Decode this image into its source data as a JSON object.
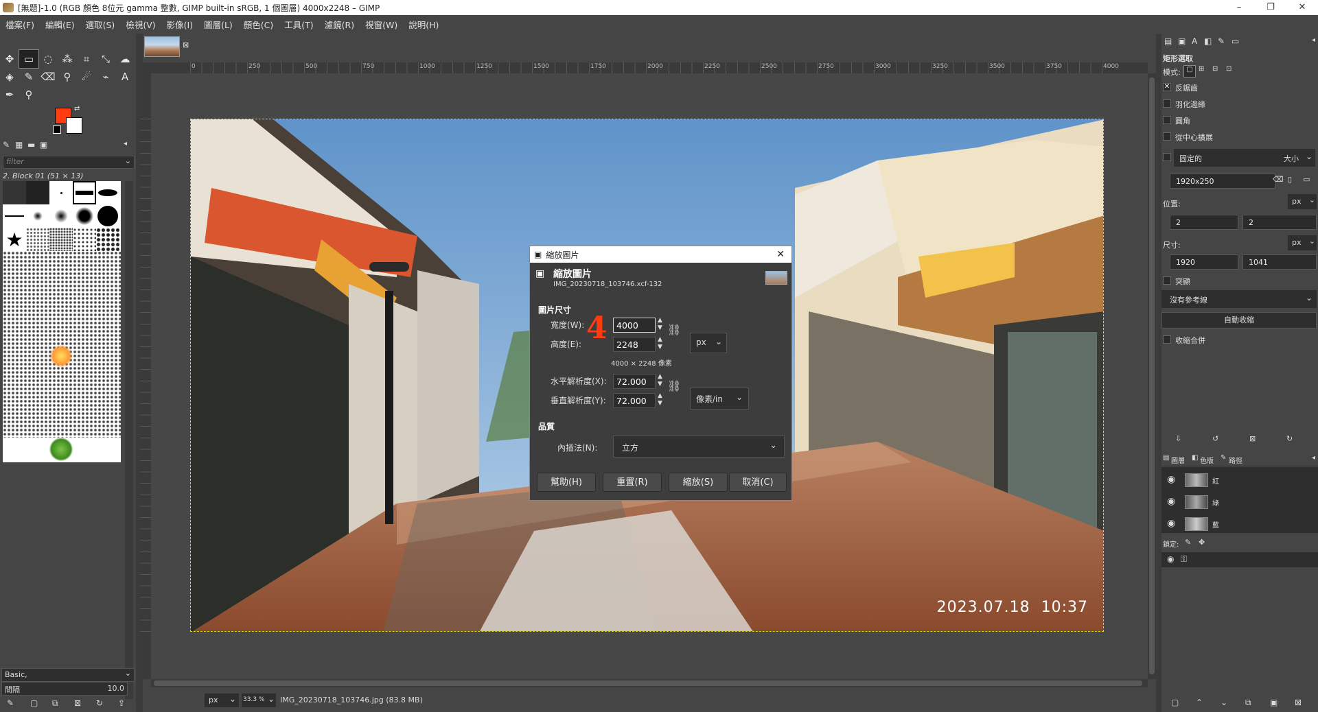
{
  "window": {
    "title": "[無題]-1.0 (RGB 顏色 8位元 gamma 整數, GIMP built-in sRGB, 1 個圖層) 4000x2248 – GIMP"
  },
  "menu": [
    "檔案(F)",
    "編輯(E)",
    "選取(S)",
    "檢視(V)",
    "影像(I)",
    "圖層(L)",
    "顏色(C)",
    "工具(T)",
    "濾鏡(R)",
    "視窗(W)",
    "說明(H)"
  ],
  "ruler_ticks": [
    "0",
    "250",
    "500",
    "750",
    "1000",
    "1250",
    "1500",
    "1750",
    "2000",
    "2250",
    "2500",
    "2750",
    "3000",
    "3250",
    "3500",
    "3750",
    "4000"
  ],
  "left_panel": {
    "filter_placeholder": "filter",
    "brush_name": "2. Block 01 (51 × 13)",
    "preset": "Basic,",
    "spacing_label": "間隔",
    "spacing_value": "10.0"
  },
  "photo": {
    "timestamp": "2023.07.18  10:37"
  },
  "dialog": {
    "title": "縮放圖片",
    "heading": "縮放圖片",
    "subtitle": "IMG_20230718_103746.xcf-132",
    "section_size": "圖片尺寸",
    "width_label": "寬度(W):",
    "width_value": "4000",
    "height_label": "高度(E):",
    "height_value": "2248",
    "size_info": "4000 × 2248 像素",
    "unit": "px",
    "xres_label": "水平解析度(X):",
    "xres_value": "72.000",
    "yres_label": "垂直解析度(Y):",
    "yres_value": "72.000",
    "res_unit": "像素/in",
    "section_quality": "品質",
    "interp_label": "內插法(N):",
    "interp_value": "立方",
    "btn_help": "幫助(H)",
    "btn_reset": "重置(R)",
    "btn_scale": "縮放(S)",
    "btn_cancel": "取消(C)",
    "annotation": "4"
  },
  "right_panel": {
    "tool_title": "矩形選取",
    "mode_label": "模式:",
    "antialias": "反鋸齒",
    "feather": "羽化邊緣",
    "rounded": "圓角",
    "expand": "從中心擴展",
    "fixed": "固定的",
    "fixed_option": "大小",
    "fixed_value": "1920x250",
    "position_label": "位置:",
    "pos_unit": "px",
    "pos_x": "2",
    "pos_y": "2",
    "size_label": "尺寸:",
    "size_unit": "px",
    "size_w": "1920",
    "size_h": "1041",
    "highlight": "突顯",
    "guides": "沒有參考線",
    "auto_shrink": "自動收縮",
    "shrink_merged": "收縮合併"
  },
  "layers_panel": {
    "tabs": [
      "圖層",
      "色版",
      "路徑"
    ],
    "channels": [
      "紅",
      "綠",
      "藍"
    ],
    "lock_label": "鎖定:"
  },
  "statusbar": {
    "unit": "px",
    "zoom": "33.3 %",
    "file": "IMG_20230718_103746.jpg (83.8 MB)"
  },
  "colors": {
    "fg": "#ff3c0f",
    "bg": "#ffffff",
    "accent": "#e0e000"
  }
}
